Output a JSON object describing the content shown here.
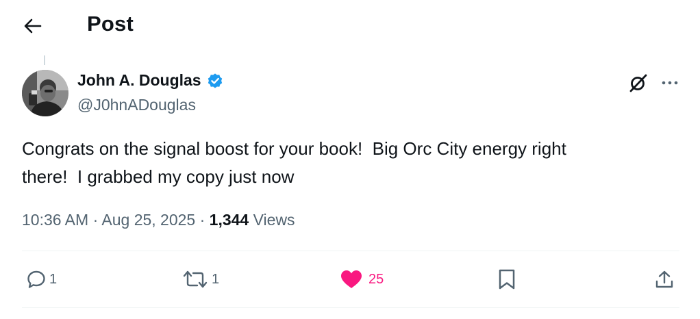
{
  "header": {
    "title": "Post"
  },
  "post": {
    "author": {
      "name": "John A. Douglas",
      "handle": "@J0hnADouglas",
      "verified": true
    },
    "text": "Congrats on the signal boost for your book!  Big Orc City energy right\nthere!  I grabbed my copy just now",
    "time": "10:36 AM",
    "date": "Aug 25, 2025",
    "separator": "·",
    "views_count": "1,344",
    "views_label": "Views"
  },
  "actions": {
    "reply_count": "1",
    "repost_count": "1",
    "like_count": "25",
    "liked": true
  },
  "icons": [
    "back-arrow-icon",
    "verified-badge-icon",
    "grok-icon",
    "more-icon",
    "reply-icon",
    "repost-icon",
    "heart-icon",
    "bookmark-icon",
    "share-icon"
  ],
  "colors": {
    "accent": "#1d9bf0",
    "like": "#f91880",
    "secondary_text": "#536471",
    "primary_text": "#0f1419"
  }
}
